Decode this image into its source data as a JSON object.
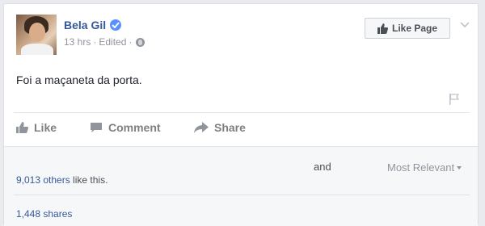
{
  "post": {
    "author": "Bela Gil",
    "time": "13 hrs",
    "edited": "Edited",
    "separator": "·",
    "text": "Foi a maçaneta da porta."
  },
  "header": {
    "like_page_label": "Like Page"
  },
  "actions": {
    "like": "Like",
    "comment": "Comment",
    "share": "Share"
  },
  "feedback": {
    "and_text": "and",
    "sort_label": "Most Relevant",
    "others_count": "9,013 others",
    "likes_suffix": " like this.",
    "shares": "1,448 shares"
  },
  "colors": {
    "link": "#365899",
    "verified": "#5890ff",
    "muted": "#90949c"
  }
}
